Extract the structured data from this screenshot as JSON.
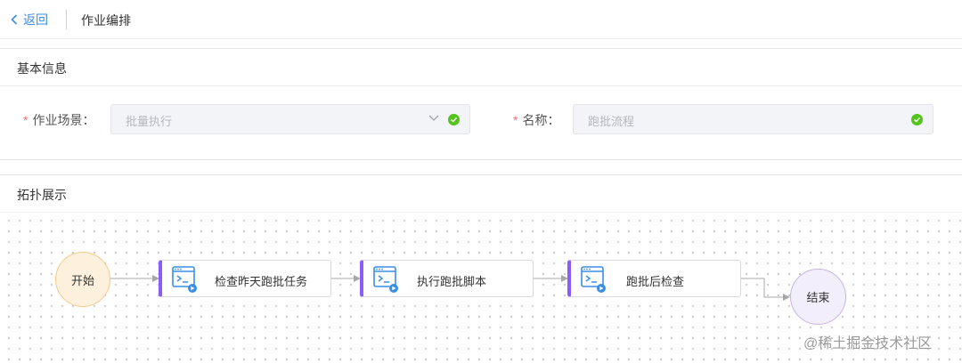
{
  "header": {
    "back_label": "返回",
    "title": "作业编排"
  },
  "basic_info": {
    "title": "基本信息",
    "scene": {
      "label": "作业场景：",
      "required": "*",
      "value": "批量执行"
    },
    "name": {
      "label": "名称：",
      "required": "*",
      "value": "跑批流程"
    }
  },
  "topology": {
    "title": "拓扑展示",
    "start": "开始",
    "end": "结束",
    "tasks": [
      {
        "label": "检查昨天跑批任务"
      },
      {
        "label": "执行跑批脚本"
      },
      {
        "label": "跑批后检查"
      }
    ]
  },
  "watermark": "@稀土掘金技术社区",
  "colors": {
    "accent": "#3a8ee6",
    "required": "#f56c6c",
    "ok": "#52c41a",
    "task_bar": "#8b5cf6",
    "start_fill": "#fdf1dd",
    "end_fill": "#f3eefb"
  },
  "icons": {
    "back": "chevron-left-icon",
    "dropdown": "chevron-down-icon",
    "valid": "check-circle-icon",
    "task": "terminal-icon"
  }
}
